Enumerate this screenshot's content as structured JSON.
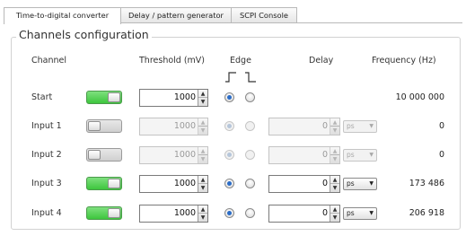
{
  "tabs": [
    {
      "label": "Time-to-digital converter"
    },
    {
      "label": "Delay / pattern generator"
    },
    {
      "label": "SCPI Console"
    }
  ],
  "group_title": "Channels configuration",
  "headers": {
    "channel": "Channel",
    "threshold": "Threshold (mV)",
    "edge": "Edge",
    "delay": "Delay",
    "frequency": "Frequency (Hz)"
  },
  "channels": [
    {
      "name": "Start",
      "enabled": true,
      "threshold": "1000",
      "edge": "rising",
      "delay": "",
      "unit": "",
      "frequency": "10 000 000"
    },
    {
      "name": "Input 1",
      "enabled": false,
      "threshold": "1000",
      "edge": "rising",
      "delay": "0",
      "unit": "ps",
      "frequency": "0"
    },
    {
      "name": "Input 2",
      "enabled": false,
      "threshold": "1000",
      "edge": "rising",
      "delay": "0",
      "unit": "ps",
      "frequency": "0"
    },
    {
      "name": "Input 3",
      "enabled": true,
      "threshold": "1000",
      "edge": "rising",
      "delay": "0",
      "unit": "ps",
      "frequency": "173 486"
    },
    {
      "name": "Input 4",
      "enabled": true,
      "threshold": "1000",
      "edge": "rising",
      "delay": "0",
      "unit": "ps",
      "frequency": "206 918"
    }
  ],
  "icons": {
    "spin_up": "▲",
    "spin_down": "▼",
    "dropdown": "▼"
  },
  "colors": {
    "toggle_on": "#3ec63e",
    "radio_selected": "#2a6cc7"
  }
}
